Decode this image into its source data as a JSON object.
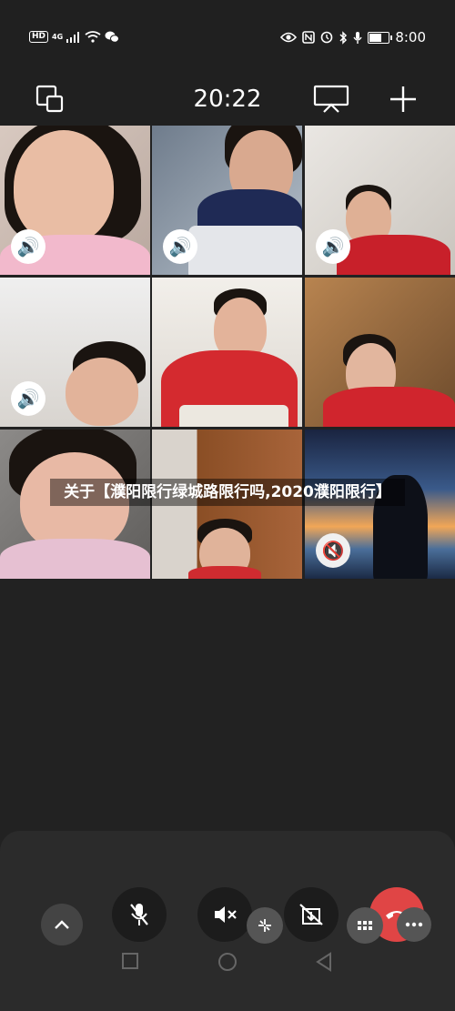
{
  "status_bar": {
    "left_icons": [
      "HD",
      "4G",
      "signal-icon",
      "wifi-icon",
      "wechat-icon"
    ],
    "right_icons": [
      "eye-icon",
      "nfc-icon",
      "alarm-icon",
      "bluetooth-icon",
      "mic-icon"
    ],
    "battery_level": 0.7,
    "time": "8:00"
  },
  "call": {
    "duration": "20:22"
  },
  "participants": [
    {
      "mic": "on"
    },
    {
      "mic": "on"
    },
    {
      "mic": "on"
    },
    {
      "mic": "on"
    },
    {
      "mic": "none"
    },
    {
      "mic": "none"
    },
    {
      "mic": "none"
    },
    {
      "mic": "none"
    },
    {
      "mic": "muted"
    }
  ],
  "overlay_caption": "关于【濮阳限行绿城路限行吗,2020濮阳限行】",
  "controls": [
    "collapse-icon",
    "mute-mic-icon",
    "speaker-off-icon",
    "effects-icon",
    "camera-off-icon",
    "hangup-icon",
    "grid-icon",
    "more-icon"
  ],
  "colors": {
    "accent_green": "#2aa847",
    "hangup_red": "#e04545",
    "panel": "#2b2b2b"
  }
}
